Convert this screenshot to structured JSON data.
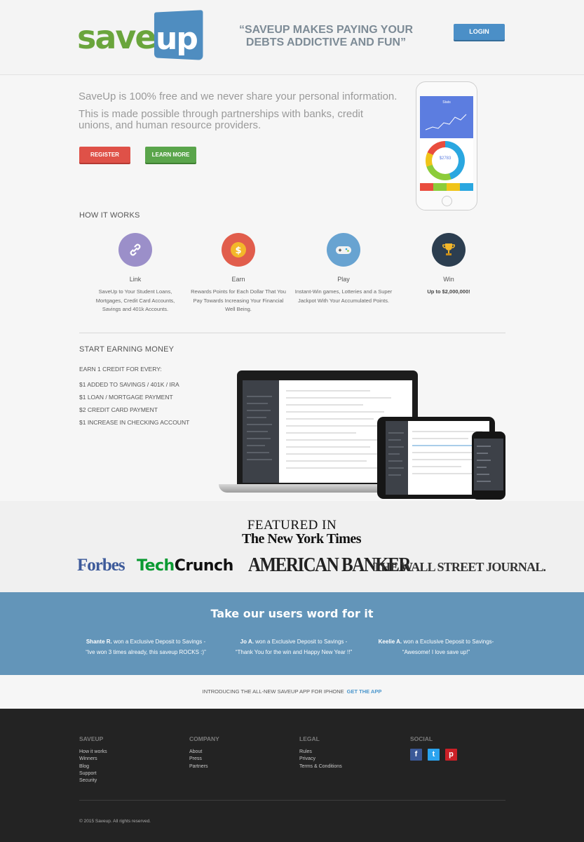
{
  "header": {
    "logo_save": "save",
    "logo_up": "up",
    "tagline": "“SAVEUP MAKES PAYING YOUR DEBTS ADDICTIVE AND FUN”",
    "login_label": "LOGIN"
  },
  "hero": {
    "intro_line1": "SaveUp is 100% free and we never share your personal information.",
    "intro_line2": "This is made possible through partnerships with banks, credit unions, and human resource providers.",
    "register_label": "REGISTER",
    "learn_more_label": "LEARN MORE",
    "phone_title": "Stats",
    "phone_amount": "$2783"
  },
  "how_it_works": {
    "title": "HOW IT WORKS",
    "steps": [
      {
        "title": "Link",
        "desc": "SaveUp to Your Student Loans, Mortgages, Credit Card Accounts, Savings and 401k Accounts.",
        "icon": "link-icon",
        "color": "#9b8fc9"
      },
      {
        "title": "Earn",
        "desc": "Rewards Points for Each Dollar That You Pay Towards Increasing Your Financial Well Being.",
        "icon": "coin-icon",
        "color": "#e15d4c"
      },
      {
        "title": "Play",
        "desc": "Instant-Win games, Lotteries and a Super Jackpot With Your Accumulated Points.",
        "icon": "gamepad-icon",
        "color": "#68a3d1"
      },
      {
        "title": "Win",
        "desc": "Up to $2,000,000!",
        "icon": "trophy-icon",
        "color": "#2c3e50"
      }
    ]
  },
  "earning": {
    "title": "START EARNING MONEY",
    "subtitle": "EARN 1 CREDIT FOR EVERY:",
    "items": [
      "$1 ADDED TO SAVINGS / 401K / IRA",
      "$1 LOAN / MORTGAGE PAYMENT",
      "$2 CREDIT CARD PAYMENT",
      "$1 INCREASE IN CHECKING ACCOUNT"
    ]
  },
  "featured": {
    "title": "FEATURED IN",
    "logos": {
      "nyt": "The New York Times",
      "forbes": "Forbes",
      "techcrunch_a": "Tech",
      "techcrunch_b": "Crunch",
      "american_banker": "AMERICAN BANKER",
      "wsj": "THE WALL STREET JOURNAL."
    }
  },
  "testimonials": {
    "title": "Take our users word for it",
    "items": [
      {
        "name": "Shante R.",
        "action": " won a Exclusive Deposit to Savings -",
        "quote": "“Ive won 3 times already, this saveup ROCKS :)”"
      },
      {
        "name": "Jo A.",
        "action": " won a Exclusive Deposit to Savings -",
        "quote": "“Thank You for the win and Happy New Year !!”"
      },
      {
        "name": "Keelie A.",
        "action": " won a Exclusive Deposit to Savings-",
        "quote": "“Awesome! I love save up!”"
      }
    ]
  },
  "app_bar": {
    "text": "INTRODUCING THE ALL-NEW SAVEUP APP FOR IPHONE",
    "link": "GET THE APP"
  },
  "footer": {
    "columns": [
      {
        "heading": "SAVEUP",
        "links": [
          "How it works",
          "Winners",
          "Blog",
          "Support",
          "Security"
        ]
      },
      {
        "heading": "COMPANY",
        "links": [
          "About",
          "Press",
          "Partners"
        ]
      },
      {
        "heading": "LEGAL",
        "links": [
          "Rules",
          "Privacy",
          "Terms & Conditions"
        ]
      }
    ],
    "social_heading": "SOCIAL",
    "social": [
      {
        "icon": "facebook-icon",
        "glyph": "f",
        "color": "#3b5998"
      },
      {
        "icon": "twitter-icon",
        "glyph": "t",
        "color": "#2aa3ef"
      },
      {
        "icon": "pinterest-icon",
        "glyph": "p",
        "color": "#cb2027"
      }
    ],
    "copyright": "© 2015 Saveup. All rights reserved."
  }
}
